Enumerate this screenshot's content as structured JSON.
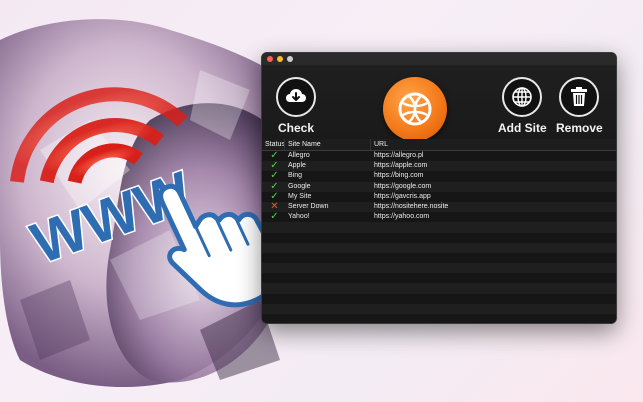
{
  "toolbar": {
    "check_label": "Check",
    "add_label": "Add Site",
    "remove_label": "Remove"
  },
  "table": {
    "headers": {
      "status": "Status",
      "name": "Site Name",
      "url": "URL"
    },
    "rows": [
      {
        "status": "up",
        "status_glyph": "✓",
        "name": "Allegro",
        "url": "https://allegro.pl"
      },
      {
        "status": "up",
        "status_glyph": "✓",
        "name": "Apple",
        "url": "https://apple.com"
      },
      {
        "status": "up",
        "status_glyph": "✓",
        "name": "Bing",
        "url": "https://bing.com"
      },
      {
        "status": "up",
        "status_glyph": "✓",
        "name": "Google",
        "url": "https://google.com"
      },
      {
        "status": "up",
        "status_glyph": "✓",
        "name": "My Site",
        "url": "https://gavcris.app"
      },
      {
        "status": "down",
        "status_glyph": "✕",
        "name": "Server Down",
        "url": "https://nositehere.nosite"
      },
      {
        "status": "up",
        "status_glyph": "✓",
        "name": "Yahoo!",
        "url": "https://yahoo.com"
      }
    ],
    "empty_rows": 10
  },
  "art": {
    "www_text": "WWW"
  },
  "colors": {
    "ok": "#4cd44c",
    "bad": "#ff4a3a",
    "accent": "#f47a1a",
    "www_blue": "#2f6db3"
  },
  "icons": {
    "check": "cloud-download-icon",
    "logo": "globe-icon",
    "add": "globe-grid-icon",
    "remove": "trash-icon",
    "pointer": "hand-pointer-icon"
  }
}
